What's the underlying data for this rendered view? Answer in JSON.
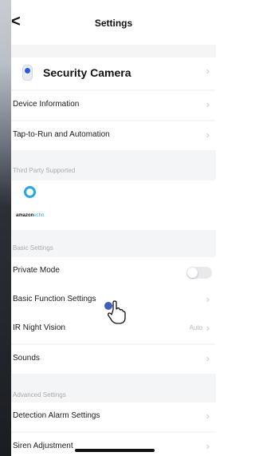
{
  "header": {
    "back_icon": "chevron-left-icon",
    "back_glyph": "<",
    "title": "Settings"
  },
  "device": {
    "icon": "camera-icon",
    "name": "Security Camera"
  },
  "rows_top": [
    {
      "label": "Device Information"
    },
    {
      "label": "Tap-to-Run and Automation"
    }
  ],
  "third_party": {
    "section_label": "Third Party Supported",
    "alexa": {
      "icon": "alexa-icon",
      "brand": "amazon",
      "product": "echo"
    }
  },
  "basic": {
    "section_label": "Basic Settings",
    "private_mode": {
      "label": "Private Mode",
      "enabled": false
    },
    "function_settings": {
      "label": "Basic Function Settings"
    },
    "ir_night_vision": {
      "label": "IR Night Vision",
      "value": "Auto"
    },
    "sounds": {
      "label": "Sounds"
    }
  },
  "advanced": {
    "section_label": "Advanced Settings",
    "detection_alarm": {
      "label": "Detection Alarm Settings"
    },
    "siren": {
      "label": "Siren Adjustment"
    }
  },
  "chevron_glyph": "›",
  "colors": {
    "accent": "#2aa7e0",
    "toggle_off": "#e8e9eb",
    "cursor_dot": "#2b4fb4"
  }
}
